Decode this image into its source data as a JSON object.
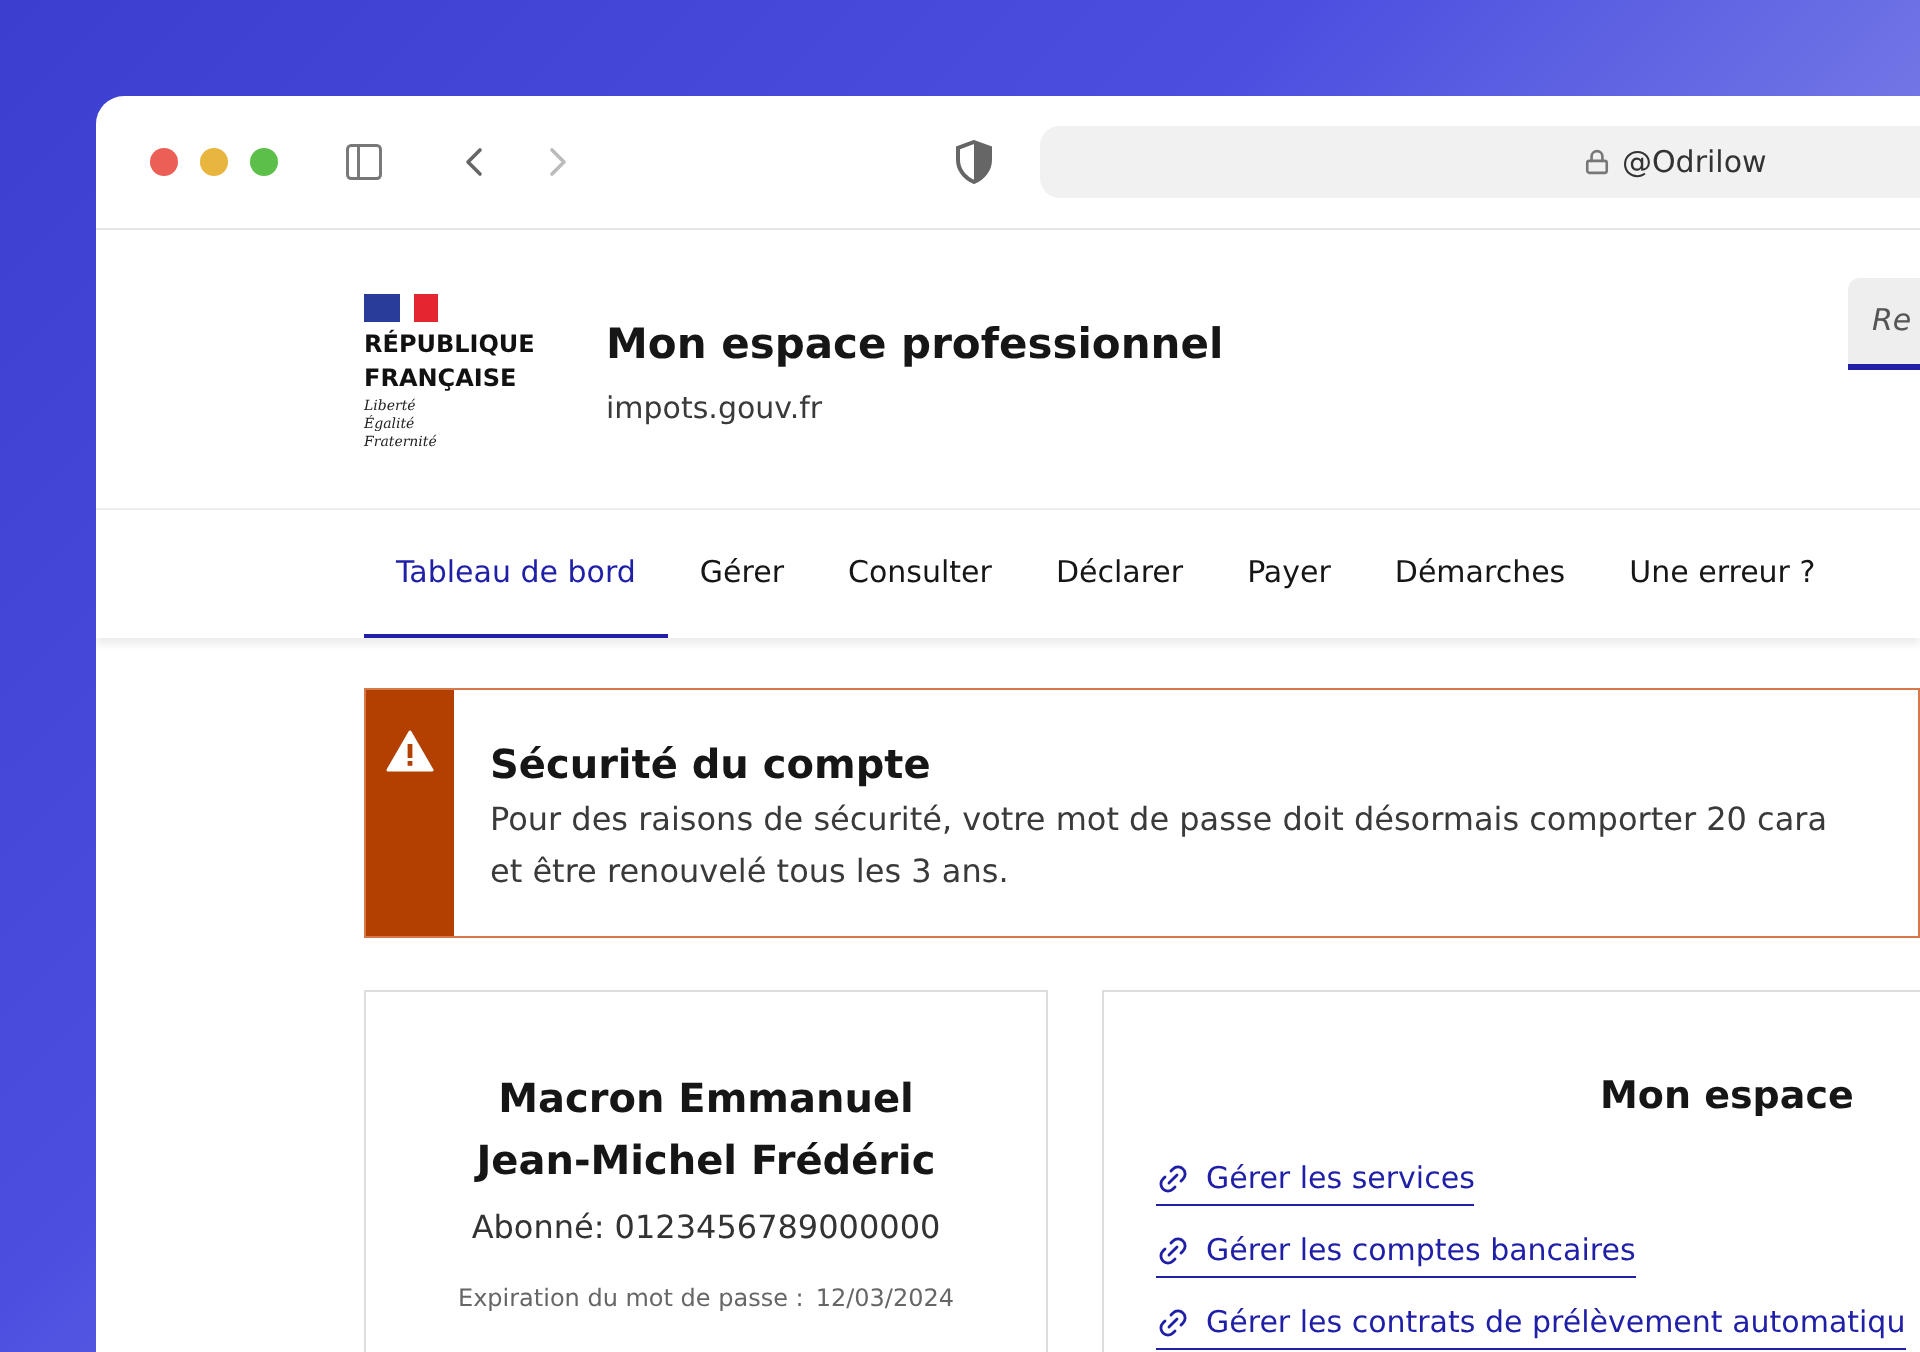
{
  "browser": {
    "address": "@Odrilow"
  },
  "header": {
    "logo_lines": [
      "RÉPUBLIQUE",
      "FRANÇAISE"
    ],
    "motto": [
      "Liberté",
      "Égalité",
      "Fraternité"
    ],
    "title": "Mon espace professionnel",
    "subtitle": "impots.gouv.fr",
    "button": "Re"
  },
  "nav": [
    {
      "label": "Tableau de bord",
      "selected": true
    },
    {
      "label": "Gérer",
      "selected": false
    },
    {
      "label": "Consulter",
      "selected": false
    },
    {
      "label": "Déclarer",
      "selected": false
    },
    {
      "label": "Payer",
      "selected": false
    },
    {
      "label": "Démarches",
      "selected": false
    },
    {
      "label": "Une erreur ?",
      "selected": false
    }
  ],
  "alert": {
    "title": "Sécurité du compte",
    "lines": [
      "Pour des raisons de sécurité, votre mot de passe doit désormais comporter 20 cara",
      "et être renouvelé tous les 3 ans."
    ]
  },
  "profile": {
    "name_lines": [
      "Macron Emmanuel",
      "Jean-Michel Frédéric"
    ],
    "subscriber": "Abonné: 0123456789000000",
    "expiry_label": "Expiration du mot de passe :",
    "expiry_date": "12/03/2024"
  },
  "space": {
    "title": "Mon espace",
    "links": [
      "Gérer les services",
      "Gérer les comptes bancaires",
      "Gérer les contrats de prélèvement automatiqu"
    ]
  }
}
